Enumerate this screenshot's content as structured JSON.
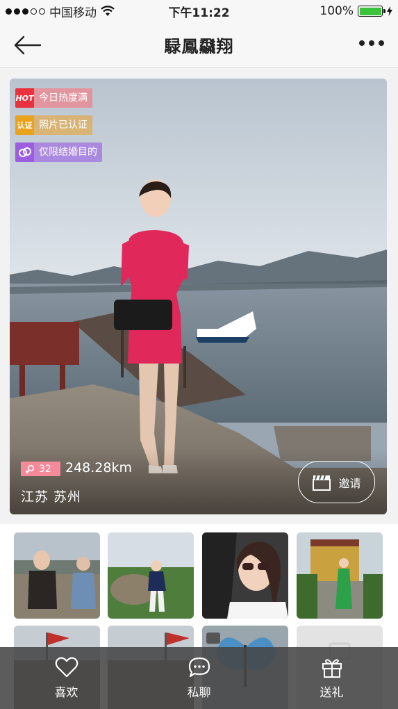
{
  "status_bar": {
    "carrier": "中国移动",
    "time": "下午11:22",
    "battery_percent": "100%",
    "battery_level": 1.0
  },
  "nav": {
    "title": "騄鳳飝翔",
    "back_icon": "arrow-left-icon",
    "more_icon": "more-horizontal-icon"
  },
  "profile": {
    "tags": [
      {
        "icon_label": "HOT",
        "text": "今日热度满",
        "color": "#e8333f"
      },
      {
        "icon_label": "认证",
        "text": "照片已认证",
        "color": "#e9a21d"
      },
      {
        "icon_label": "",
        "text": "仅限结婚目的",
        "color": "#9c5de0"
      }
    ],
    "age": "32",
    "distance": "248.28km",
    "location": "江苏 苏州",
    "invite_label": "邀请"
  },
  "bottom_bar": {
    "items": [
      {
        "label": "喜欢",
        "icon": "heart-icon"
      },
      {
        "label": "私聊",
        "icon": "chat-bubble-icon"
      },
      {
        "label": "送礼",
        "icon": "gift-icon"
      }
    ]
  },
  "colors": {
    "hot": "#e8333f",
    "verified": "#e9a21d",
    "marriage": "#9c5de0",
    "age_badge": "#f58a9b",
    "battery": "#3bc43b"
  }
}
